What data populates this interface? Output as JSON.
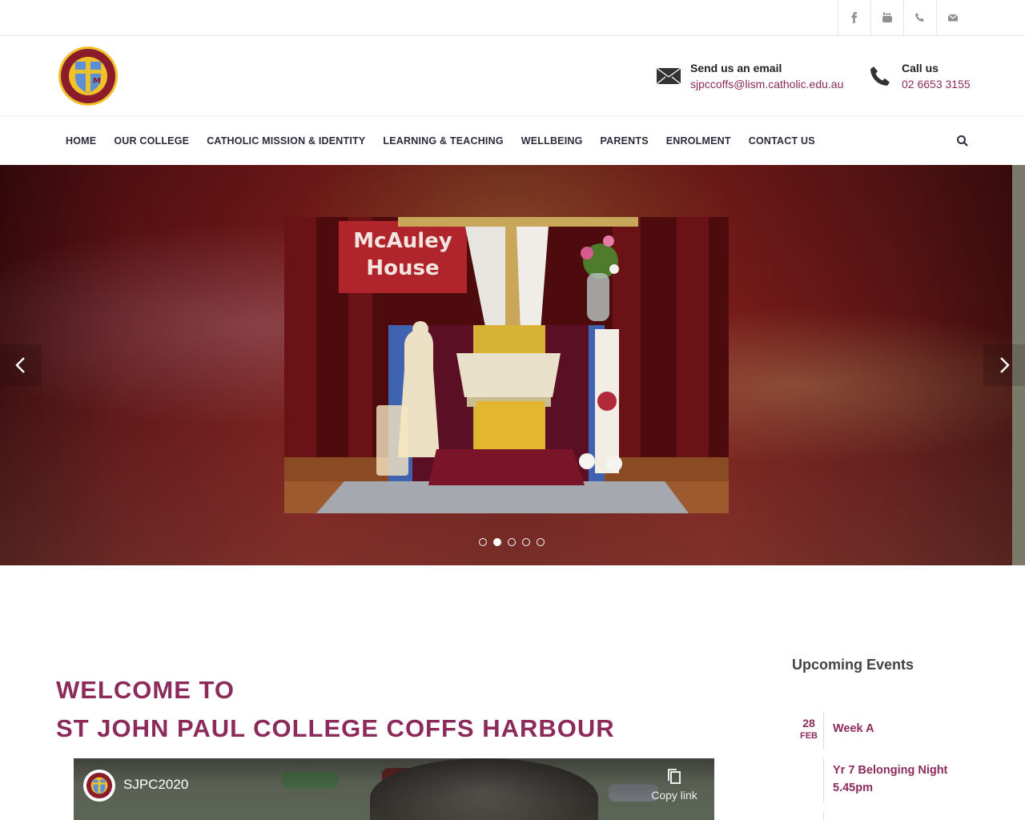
{
  "topbar": {
    "social": [
      {
        "name": "facebook-icon",
        "label": "f"
      },
      {
        "name": "youtube-icon",
        "label": "You Tube"
      },
      {
        "name": "phone-icon",
        "label": ""
      },
      {
        "name": "mail-icon",
        "label": ""
      }
    ]
  },
  "header": {
    "logo_alt": "St John Paul College Coffs Harbour crest",
    "email": {
      "title": "Send us an email",
      "value": "sjpccoffs@lism.catholic.edu.au"
    },
    "phone": {
      "title": "Call us",
      "value": "02 6653 3155"
    }
  },
  "nav": {
    "items": [
      {
        "label": "HOME"
      },
      {
        "label": "OUR COLLEGE"
      },
      {
        "label": "CATHOLIC MISSION & IDENTITY"
      },
      {
        "label": "LEARNING & TEACHING"
      },
      {
        "label": "WELLBEING"
      },
      {
        "label": "PARENTS"
      },
      {
        "label": "ENROLMENT"
      },
      {
        "label": "CONTACT US"
      }
    ]
  },
  "hero": {
    "banner_text": "McAuley\nHouse",
    "active_dot": 1,
    "dot_count": 5
  },
  "welcome": {
    "line1": "WELCOME TO",
    "line2": "ST JOHN PAUL COLLEGE COFFS HARBOUR"
  },
  "video": {
    "title": "SJPC2020",
    "copy_label": "Copy link"
  },
  "events": {
    "title": "Upcoming Events",
    "items": [
      {
        "day": "28",
        "month": "FEB",
        "title": "Week A"
      },
      {
        "day": "",
        "month": "",
        "title": "Yr 7 Belonging Night 5.45pm"
      }
    ]
  },
  "colors": {
    "brand": "#8c2b5b",
    "nav_text": "#2b2b3b"
  }
}
